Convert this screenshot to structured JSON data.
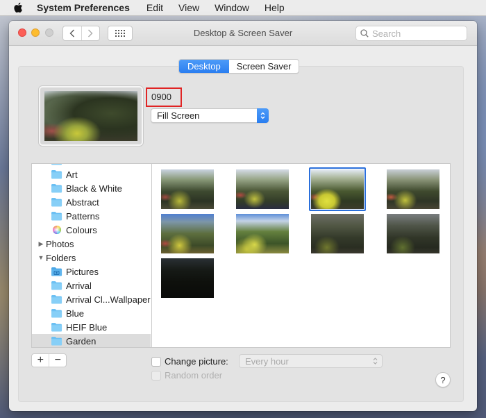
{
  "menubar": {
    "apple_icon": "apple-logo-icon",
    "items": [
      "System Preferences",
      "Edit",
      "View",
      "Window",
      "Help"
    ]
  },
  "window": {
    "title": "Desktop & Screen Saver",
    "traffic_lights": {
      "close": "#fc5f57",
      "minimize": "#fdbc2e",
      "zoom": "#cfcfcf"
    },
    "nav": {
      "back_icon": "chevron-left-icon",
      "forward_icon": "chevron-right-icon",
      "grid_icon": "show-all-grid-icon"
    },
    "search": {
      "placeholder": "Search",
      "value": ""
    }
  },
  "tabs": [
    {
      "label": "Desktop",
      "active": true
    },
    {
      "label": "Screen Saver",
      "active": false
    }
  ],
  "accent_color": "#2a7ef0",
  "current": {
    "picture_name": "0900",
    "fit_option": "Fill Screen",
    "highlight_color": "#e02424"
  },
  "sidebar": {
    "items": [
      {
        "label": "Art",
        "icon": "folder-icon",
        "level": 1
      },
      {
        "label": "Black & White",
        "icon": "folder-icon",
        "level": 1
      },
      {
        "label": "Abstract",
        "icon": "folder-icon",
        "level": 1
      },
      {
        "label": "Patterns",
        "icon": "folder-icon",
        "level": 1
      },
      {
        "label": "Colours",
        "icon": "color-wheel-icon",
        "level": 1
      },
      {
        "label": "Photos",
        "icon": "disclosure-collapsed",
        "level": 0
      },
      {
        "label": "Folders",
        "icon": "disclosure-expanded",
        "level": 0
      },
      {
        "label": "Pictures",
        "icon": "pictures-folder-icon",
        "level": 1
      },
      {
        "label": "Arrival",
        "icon": "folder-icon",
        "level": 1
      },
      {
        "label": "Arrival Cl...Wallpaper",
        "icon": "folder-icon",
        "level": 1
      },
      {
        "label": "Blue",
        "icon": "folder-icon",
        "level": 1
      },
      {
        "label": "HEIF Blue",
        "icon": "folder-icon",
        "level": 1
      },
      {
        "label": "Garden",
        "icon": "folder-icon",
        "level": 1,
        "selected": true
      }
    ]
  },
  "thumbnails": {
    "count": 9,
    "selected_index": 2
  },
  "bottom": {
    "add_label": "+",
    "remove_label": "−",
    "change_picture_label": "Change picture:",
    "change_picture_checked": false,
    "interval_value": "Every hour",
    "random_order_label": "Random order",
    "random_order_checked": false,
    "help_label": "?"
  }
}
